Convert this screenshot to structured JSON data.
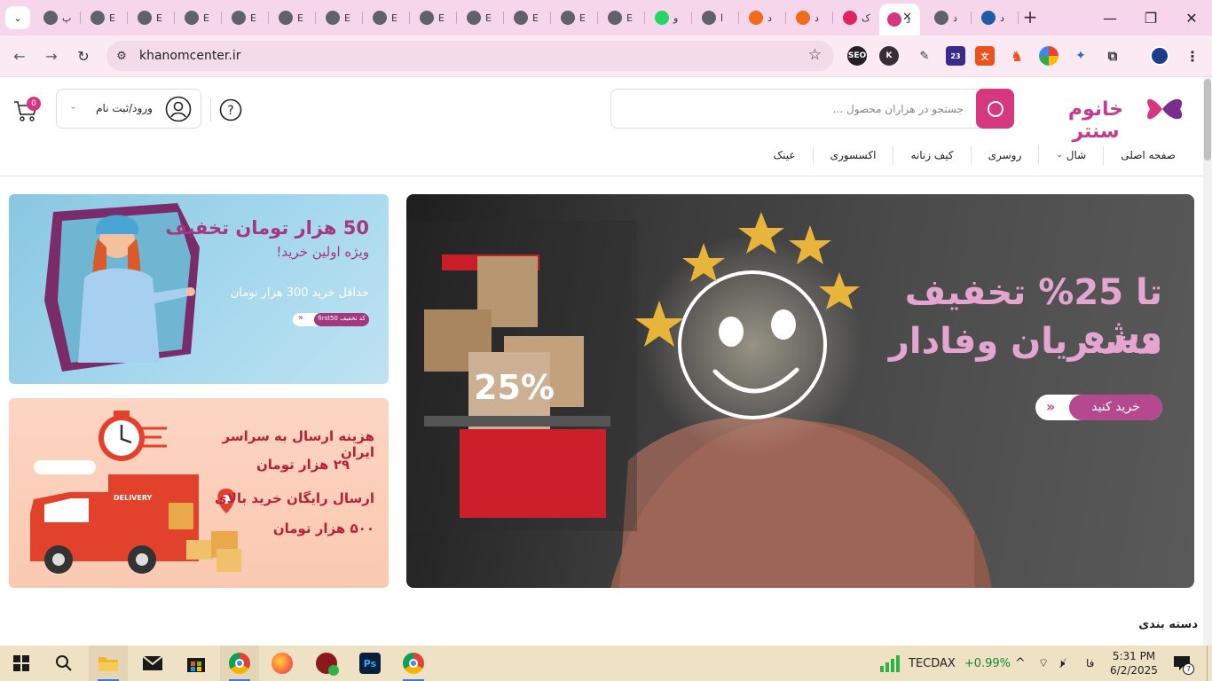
{
  "browser": {
    "tabs": [
      {
        "label": "پ",
        "icon": "globe-icon"
      },
      {
        "label": "E",
        "icon": "globe-icon"
      },
      {
        "label": "E",
        "icon": "globe-icon"
      },
      {
        "label": "E",
        "icon": "globe-icon"
      },
      {
        "label": "E",
        "icon": "globe-icon"
      },
      {
        "label": "E",
        "icon": "globe-icon"
      },
      {
        "label": "E",
        "icon": "globe-icon"
      },
      {
        "label": "E",
        "icon": "globe-icon"
      },
      {
        "label": "E",
        "icon": "globe-icon"
      },
      {
        "label": "E",
        "icon": "globe-icon"
      },
      {
        "label": "E",
        "icon": "globe-icon"
      },
      {
        "label": "E",
        "icon": "globe-icon"
      },
      {
        "label": "E",
        "icon": "globe-icon"
      },
      {
        "label": "و",
        "icon": "whatsapp-icon"
      },
      {
        "label": "ا",
        "icon": "globe-icon"
      },
      {
        "label": "د",
        "icon": "orange-app-icon"
      },
      {
        "label": "د",
        "icon": "orange-app-icon"
      },
      {
        "label": "ک",
        "icon": "red-app-icon"
      },
      {
        "label": "د",
        "icon": "site-icon",
        "active": true
      },
      {
        "label": "د",
        "icon": "globe-icon"
      },
      {
        "label": "د",
        "icon": "ns-icon"
      }
    ],
    "url": "khanomcenter.ir",
    "accent": "#f6d6ea",
    "extensions": [
      "seo-extension-icon",
      "k-extension-icon",
      "pen-extension-icon",
      "cap-extension-icon",
      "translate-extension-icon",
      "fox-extension-icon",
      "color-extension-icon",
      "pin-extension-icon",
      "puzzle-icon",
      "profile-avatar-icon",
      "more-menu-icon"
    ],
    "ext_badge": "23"
  },
  "site": {
    "logo_text": "خانوم سنتر",
    "search_placeholder": "جستجو در هزاران محصول ...",
    "login_label": "ورود/ثبت نام",
    "cart_count": "0",
    "brand_color": "#d6387f",
    "menu": [
      {
        "label": "صفحه اصلی"
      },
      {
        "label": "شال",
        "has_dropdown": true
      },
      {
        "label": "روسری"
      },
      {
        "label": "کیف زنانه"
      },
      {
        "label": "اکسسوری"
      },
      {
        "label": "عینک"
      }
    ],
    "hero": {
      "line1": "تا 25% تخفیف ویژه",
      "line2": "مشتریان وفادار",
      "cta": "خرید کنید",
      "box_label": "25%"
    },
    "banner_discount": {
      "title": "50 هزار تومان تخفیف",
      "subtitle": "ویژه اولین خرید!",
      "min": "حداقل خرید 300 هزار تومان",
      "code": "کد تخفیف first50"
    },
    "banner_shipping": {
      "line1": "هزینه ارسال به سراسر ایران",
      "line2": "۲۹ هزار تومان",
      "line3": "ارسال رایگان خرید بالای",
      "line4": "۵۰۰ هزار تومان",
      "truck_label": "DELIVERY"
    },
    "section_title": "دسته بندی"
  },
  "taskbar": {
    "ticker_name": "TECDAX",
    "ticker_change": "+0.99%",
    "lang": "فا",
    "time": "5:31 PM",
    "date": "6/2/2025",
    "notifications": "7"
  }
}
